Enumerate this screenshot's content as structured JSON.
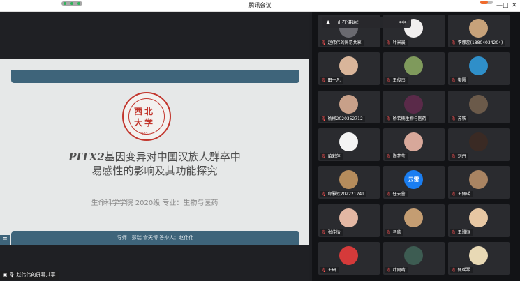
{
  "window": {
    "title": "腾讯会议",
    "minimize": "—",
    "maximize": "□",
    "close": "✕"
  },
  "slide": {
    "seal_chars": [
      "西",
      "北",
      "大",
      "学"
    ],
    "seal_year": "1902",
    "title_em": "PITX2",
    "title_line1_rest": "基因变异对中国汉族人群卒中",
    "title_line2": "易感性的影响及其功能探究",
    "subtitle": "生命科学学院  2020级   专业：生物与医药",
    "footer": "导师：彭瑞  俞天博    答辩人：赵伟伟",
    "side_btn": "☰"
  },
  "share_label": "赵伟伟的屏幕共享",
  "speaking": {
    "label": "正在讲话：",
    "dots": "◂◂◂"
  },
  "participants": [
    {
      "name": "赵伟伟的屏幕共享",
      "avatar": "#6a6a70",
      "kind": "share"
    },
    {
      "name": "叶景晨",
      "avatar": "#f1efef"
    },
    {
      "name": "李娜蕊(18804034204)",
      "avatar": "#c7a27a"
    },
    {
      "name": "田一凡",
      "avatar": "#d9b59a"
    },
    {
      "name": "王俊杰",
      "avatar": "#7f9a5c"
    },
    {
      "name": "樊圆",
      "avatar": "#2f8fc9"
    },
    {
      "name": "杨柳2020352712",
      "avatar": "#c8a089"
    },
    {
      "name": "杨若楠生物与医药",
      "avatar": "#5a2a49"
    },
    {
      "name": "苏铁",
      "avatar": "#6b5a4a"
    },
    {
      "name": "苗彩萍",
      "avatar": "#f4f4f4"
    },
    {
      "name": "陶梦莹",
      "avatar": "#d8a89a"
    },
    {
      "name": "刘丹",
      "avatar": "#3a2a24"
    },
    {
      "name": "邱雅钦202221241",
      "avatar": "#b58c5c"
    },
    {
      "name": "任云蕾",
      "avatar": "#1a7ef2",
      "kind": "cloud",
      "text": "云雷"
    },
    {
      "name": "王佩瑶",
      "avatar": "#a98462"
    },
    {
      "name": "张佳怡",
      "avatar": "#e3b7a3"
    },
    {
      "name": "马欣",
      "avatar": "#c49d72"
    },
    {
      "name": "王雅恒",
      "avatar": "#e7c7a3"
    },
    {
      "name": "王研",
      "avatar": "#d53a3a"
    },
    {
      "name": "叶雨晴",
      "avatar": "#3d5c52"
    },
    {
      "name": "佩瑶琴",
      "avatar": "#e8d9b5"
    }
  ]
}
